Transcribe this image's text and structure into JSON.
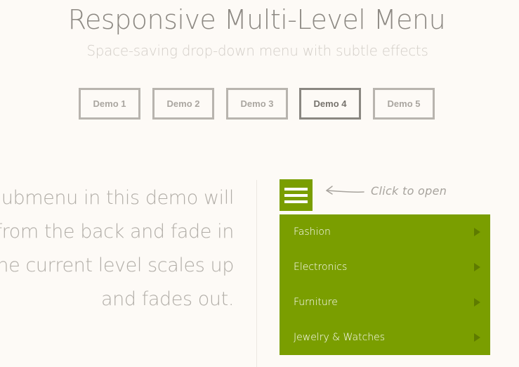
{
  "header": {
    "title": "Responsive Multi-Level Menu",
    "subtitle": "Space-saving drop-down menu with subtle effects"
  },
  "demos": [
    {
      "label": "Demo 1",
      "active": false
    },
    {
      "label": "Demo 2",
      "active": false
    },
    {
      "label": "Demo 3",
      "active": false
    },
    {
      "label": "Demo 4",
      "active": true
    },
    {
      "label": "Demo 5",
      "active": false
    }
  ],
  "description": {
    "lines": [
      "ubmenu in this demo will",
      "from the back and fade in",
      "he current level scales up",
      "and fades out."
    ]
  },
  "hint": {
    "text": "Click to open"
  },
  "menu": {
    "items": [
      {
        "label": "Fashion"
      },
      {
        "label": "Electronics"
      },
      {
        "label": "Furniture"
      },
      {
        "label": "Jewelry & Watches"
      }
    ]
  },
  "colors": {
    "background": "#fdfaf6",
    "menu_accent": "#7a9e00",
    "menu_arrow": "#5e7b00",
    "title": "#8d8983"
  },
  "icons": {
    "menu_trigger": "hamburger-icon",
    "hint_arrow": "arrow-left-icon",
    "submenu_arrow": "triangle-right-icon"
  }
}
